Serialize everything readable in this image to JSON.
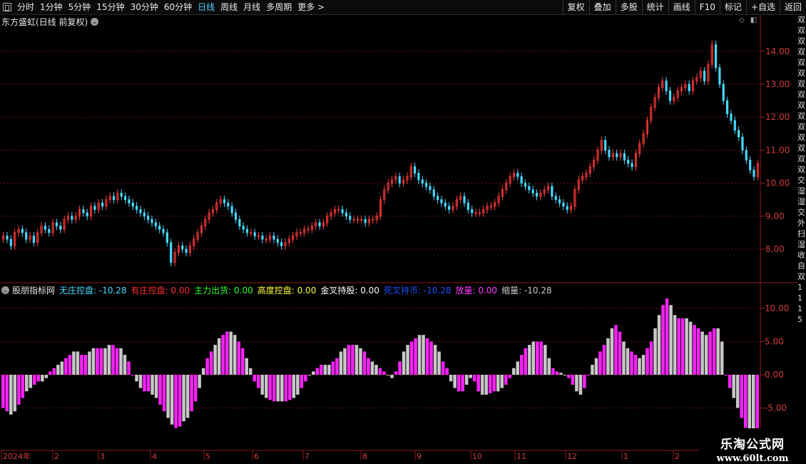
{
  "toolbar": {
    "periods": [
      "分时",
      "1分钟",
      "5分钟",
      "15分钟",
      "30分钟",
      "60分钟",
      "日线",
      "周线",
      "月线",
      "多周期",
      "更多 >"
    ],
    "active_period": "日线",
    "right_buttons": [
      "复权",
      "叠加",
      "多股",
      "统计",
      "画线",
      "F10",
      "标记",
      "+自选",
      "返回"
    ]
  },
  "main_chart": {
    "title": "东方盛虹(日线 前复权)",
    "y_labels": [
      "14.00",
      "13.00",
      "12.00",
      "11.00",
      "10.00",
      "9.00",
      "8.00"
    ],
    "y_values": [
      14,
      13,
      12,
      11,
      10,
      9,
      8
    ]
  },
  "indicator": {
    "name": "股朋指标网",
    "items": [
      {
        "label": "无庄控盘:",
        "value": "-10.28",
        "color": "#49d8ff"
      },
      {
        "label": "有庄控盘:",
        "value": "0.00",
        "color": "#ff3030"
      },
      {
        "label": "主力出货:",
        "value": "0.00",
        "color": "#30ff30"
      },
      {
        "label": "高度控盘:",
        "value": "0.00",
        "color": "#ffff40"
      },
      {
        "label": "金叉持股:",
        "value": "0.00",
        "color": "#ffffff"
      },
      {
        "label": "死叉持币:",
        "value": "-10.28",
        "color": "#2050ff"
      },
      {
        "label": "放量:",
        "value": "0.00",
        "color": "#ff40ff"
      },
      {
        "label": "缩量:",
        "value": "-10.28",
        "color": "#c8c8c8"
      }
    ],
    "y_labels": [
      "10.00",
      "5.00",
      "0.00",
      "-5.00"
    ],
    "y_values": [
      10,
      5,
      0,
      -5
    ]
  },
  "x_axis": {
    "labels": [
      "2024年",
      "2",
      "3",
      "4",
      "5",
      "6",
      "7",
      "8",
      "9",
      "10",
      "11",
      "12",
      "1",
      "2"
    ]
  },
  "right_strip": {
    "text": "双双双双双双双双双双双双双双双交湿湿交外扫湿收自双1115"
  },
  "watermark": {
    "line1": "乐淘公式网",
    "line2": "www.60lt.com"
  },
  "colors": {
    "up": "#ff3b3b",
    "down": "#48d8ff",
    "pink": "#ff22ff",
    "gray": "#c8c8c8",
    "grid": "#6b1010"
  },
  "chart_data": {
    "type": "candlestick",
    "closes": [
      8.4,
      8.3,
      8.1,
      8.5,
      8.6,
      8.5,
      8.3,
      8.4,
      8.2,
      8.5,
      8.7,
      8.6,
      8.5,
      8.8,
      8.7,
      8.6,
      8.9,
      9.0,
      8.9,
      9.0,
      9.2,
      9.1,
      9.0,
      9.3,
      9.2,
      9.4,
      9.3,
      9.5,
      9.6,
      9.5,
      9.7,
      9.6,
      9.5,
      9.4,
      9.3,
      9.2,
      9.1,
      9.0,
      8.9,
      8.8,
      8.7,
      8.6,
      8.5,
      8.2,
      7.6,
      7.9,
      8.1,
      8.0,
      7.9,
      8.1,
      8.3,
      8.5,
      8.7,
      8.9,
      9.1,
      9.2,
      9.4,
      9.5,
      9.4,
      9.3,
      9.1,
      8.9,
      8.7,
      8.6,
      8.5,
      8.5,
      8.4,
      8.4,
      8.3,
      8.3,
      8.4,
      8.3,
      8.2,
      8.1,
      8.2,
      8.3,
      8.4,
      8.5,
      8.5,
      8.6,
      8.6,
      8.7,
      8.8,
      8.7,
      8.8,
      9.0,
      9.1,
      9.2,
      9.2,
      9.1,
      9.0,
      8.9,
      8.9,
      8.9,
      8.9,
      8.8,
      8.9,
      8.9,
      9.0,
      9.5,
      9.8,
      10.0,
      10.1,
      10.2,
      10.0,
      10.1,
      10.2,
      10.5,
      10.3,
      10.1,
      10.0,
      9.9,
      9.8,
      9.6,
      9.5,
      9.4,
      9.3,
      9.2,
      9.3,
      9.5,
      9.6,
      9.4,
      9.2,
      9.1,
      9.1,
      9.1,
      9.2,
      9.3,
      9.3,
      9.4,
      9.6,
      9.8,
      10.0,
      10.2,
      10.3,
      10.2,
      10.0,
      9.9,
      9.8,
      9.7,
      9.6,
      9.7,
      9.8,
      9.9,
      9.6,
      9.5,
      9.4,
      9.3,
      9.2,
      9.3,
      9.8,
      10.1,
      10.2,
      10.3,
      10.5,
      10.7,
      11.0,
      11.3,
      11.0,
      10.8,
      10.9,
      10.8,
      10.9,
      10.7,
      10.6,
      10.5,
      10.9,
      11.2,
      11.5,
      11.9,
      12.3,
      12.6,
      12.9,
      13.1,
      12.8,
      12.5,
      12.6,
      12.8,
      12.9,
      13.0,
      12.8,
      13.1,
      13.2,
      13.4,
      13.1,
      13.6,
      14.2,
      13.5,
      13.0,
      12.5,
      12.1,
      11.9,
      11.6,
      11.4,
      11.0,
      10.7,
      10.4,
      10.2,
      10.6
    ],
    "indicator_values": [
      -5,
      -5.5,
      -6,
      -5.5,
      -4.5,
      -3.5,
      -2.5,
      -2.0,
      -1.5,
      -1.0,
      -1.0,
      -0.5,
      0.5,
      1.0,
      1.5,
      2.0,
      2.5,
      3.0,
      3.5,
      3.5,
      3.0,
      3.0,
      3.5,
      4.0,
      4.0,
      4.0,
      4.0,
      4.5,
      4.5,
      4.0,
      4.0,
      3.0,
      2.0,
      0,
      -1.0,
      -2.0,
      -2.5,
      -2.5,
      -3.0,
      -3.5,
      -4.5,
      -5.5,
      -6.5,
      -7.5,
      -8.0,
      -7.8,
      -7.0,
      -6.5,
      -5.5,
      -4.0,
      -2.0,
      1.0,
      2.5,
      3.5,
      4.5,
      5.5,
      6.0,
      6.5,
      6.5,
      6.0,
      5.0,
      4.0,
      2.5,
      1.0,
      -1.0,
      -2.0,
      -3.0,
      -3.5,
      -3.8,
      -4.0,
      -4.0,
      -4.0,
      -4.0,
      -3.8,
      -3.5,
      -3.0,
      -2.0,
      -1.0,
      0,
      0.5,
      1.0,
      1.5,
      1.5,
      1.5,
      2.0,
      2.5,
      3.5,
      4.0,
      4.5,
      4.5,
      4.5,
      4.0,
      3.5,
      2.5,
      2.0,
      1.5,
      1.0,
      0.5,
      0,
      -0.5,
      0.5,
      2.0,
      3.5,
      4.5,
      5.0,
      5.5,
      6.0,
      6.0,
      5.5,
      5.0,
      4.5,
      3.5,
      2.0,
      1.0,
      -1.0,
      -2.0,
      -2.5,
      -2.5,
      -1.5,
      -0.5,
      -1.0,
      -2.5,
      -3.0,
      -3.0,
      -2.8,
      -2.5,
      -2.5,
      -2.0,
      -1.5,
      -0.5,
      1.0,
      2.0,
      3.0,
      4.0,
      4.5,
      5.0,
      5.0,
      5.0,
      4.5,
      2.5,
      1.0,
      0.5,
      0.3,
      0,
      -0.5,
      -1.5,
      -2.5,
      -3.0,
      -2.0,
      0,
      1.5,
      2.5,
      3.5,
      4.5,
      5.5,
      7.0,
      7.5,
      6.5,
      5.0,
      4.0,
      3.5,
      3.0,
      2.5,
      3.0,
      4.0,
      5.0,
      7.0,
      9.0,
      10.5,
      11.5,
      10.5,
      9.0,
      8.5,
      8.5,
      8.5,
      8.0,
      7.5,
      7.0,
      6.5,
      6.0,
      6.5,
      7.0,
      7.0,
      5.0,
      0,
      -2.0,
      -3.5,
      -5.0,
      -6.5,
      -8.0,
      -9.0,
      -10.0,
      -10.28
    ],
    "indicator_name": "股朋指标网",
    "ylim_main": [
      7.5,
      15.5
    ],
    "ylim_indicator": [
      -10.5,
      12
    ]
  }
}
